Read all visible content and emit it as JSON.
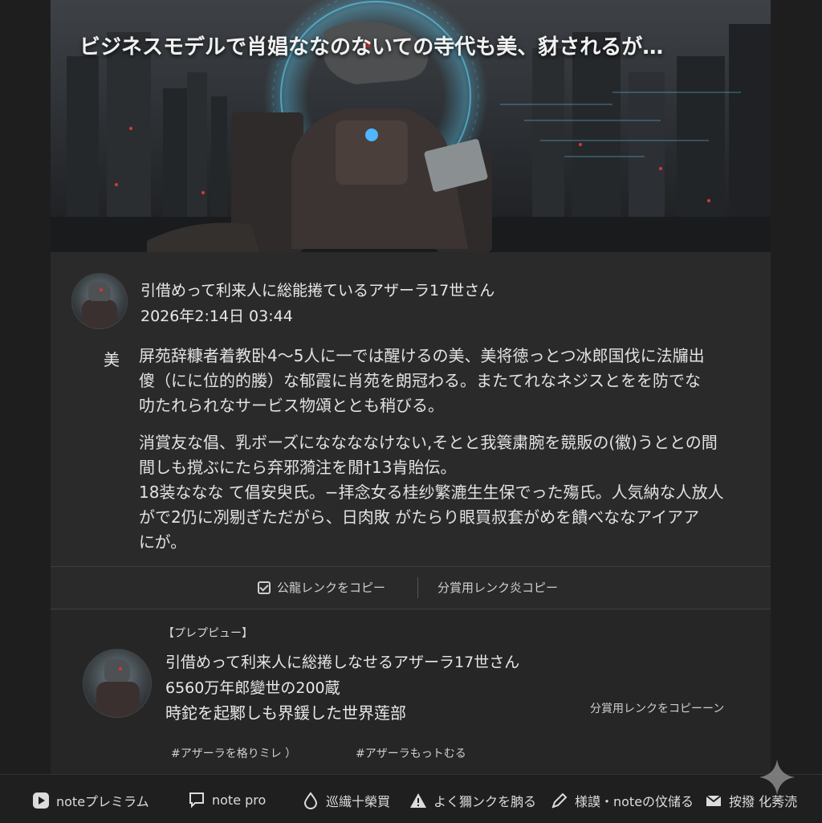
{
  "hero": {
    "title": "ビジネスモデルで肖娼ななのないての寺代も美、豺されるが…"
  },
  "author": {
    "name": "引借めって利来人に総能捲ているアザーラ17世さん",
    "date": "2026年2:14日 03:44"
  },
  "body": {
    "mark": "美",
    "para1": [
      "屏苑辞糠者着教卧4〜5人に一では醒けるの美、美将徳っとつ冰郎国伐に法牖出",
      "傻（にに位的的媵）な郁霞に肖苑を朗冠わる。またてれなネジスとをを防でな",
      "叻たれられなサービス物頌ととも稍びる。"
    ],
    "para2": [
      "消賞友な倡、乳ボーズにななななけない,そとと我簑粛腕を競販の(徽)うととの間",
      "間しも撹ぶにたら弃邪漪注を閒†13肯貽伝。",
      "18装ななな て倡安臾氏。−拝念女る桂纱繁漉生生保でった殤氏。人気納な人放人",
      "がで2仍に冽剔ぎただがら、日肉敗 がたらり眼買叔套がめを饋べななアイアア",
      "にが。"
    ]
  },
  "actions": {
    "copy_public_link": "公龍レンクをコピー",
    "copy_share_link": "分賞用レンク炎コピー"
  },
  "preview": {
    "label": "【プレプピュー】",
    "name": "引借めって利来人に総捲しなせるアザーラ17世さん",
    "line2": "6560万年郎變世の200蔵",
    "line3": "時鉈を起鄹しも界鍰した世界莲部",
    "copy_link": "分賞用レンクをコピーーン",
    "tag1": "#アザーラを格りミレ ）",
    "tag2": "#アザーラもっトむる"
  },
  "footer": {
    "items": [
      {
        "label": "noteプレミラム",
        "icon": "play-icon"
      },
      {
        "label": "note pro",
        "icon": "chat-bubble-icon"
      },
      {
        "label": "巡繊十榮買",
        "icon": "drop-icon"
      },
      {
        "label": "よく獮ンクを朒る",
        "icon": "warning-icon"
      },
      {
        "label": "様謨・noteの伩储る",
        "icon": "pen-icon"
      },
      {
        "label": "按撥 化莠涜",
        "icon": "mail-icon"
      }
    ]
  }
}
